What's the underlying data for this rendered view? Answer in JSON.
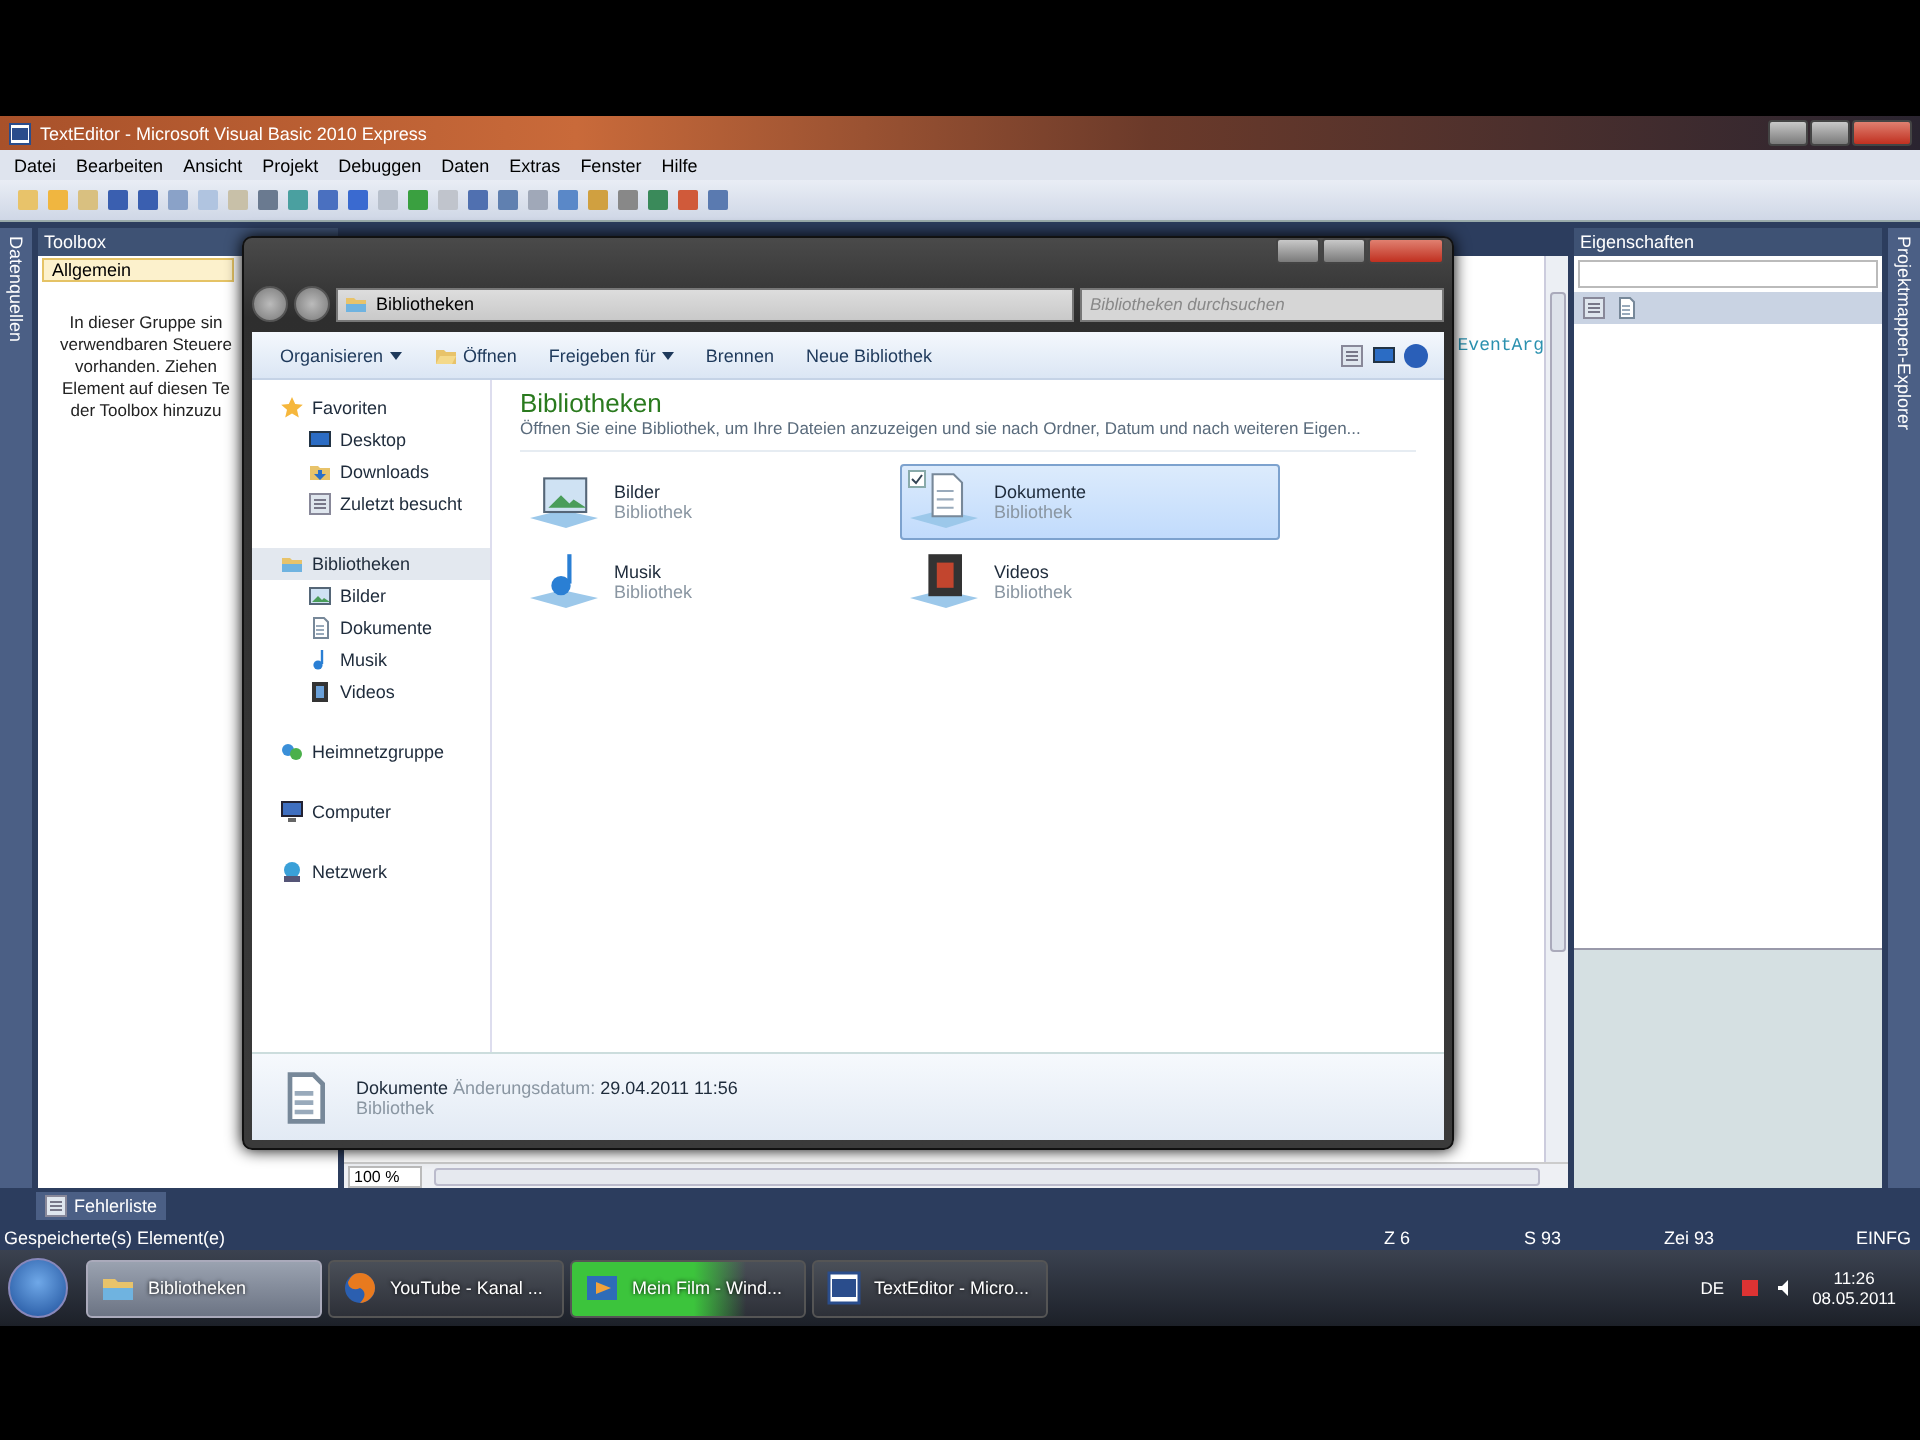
{
  "ide": {
    "title": "TextEditor - Microsoft Visual Basic 2010 Express",
    "menu": [
      "Datei",
      "Bearbeiten",
      "Ansicht",
      "Projekt",
      "Debuggen",
      "Daten",
      "Extras",
      "Fenster",
      "Hilfe"
    ],
    "left_tab": "Datenquellen",
    "toolbox": {
      "title": "Toolbox",
      "group": "Allgemein",
      "hint_lines": [
        "In dieser Gruppe sin",
        "verwendbaren Steuere",
        "vorhanden. Ziehen",
        "Element auf diesen Te",
        "der Toolbox hinzuzu"
      ]
    },
    "editor": {
      "code_fragment": "EventArg",
      "zoom": "100 %"
    },
    "properties": {
      "title": "Eigenschaften"
    },
    "right_tab": "Projektmappen-Explorer",
    "bottom_tab": "Fehlerliste",
    "status_bar": {
      "message": "Gespeicherte(s) Element(e)",
      "line": "Z 6",
      "column": "S 93",
      "char": "Zei 93",
      "mode": "EINFG"
    }
  },
  "explorer": {
    "address": "Bibliotheken",
    "search": {
      "placeholder": "Bibliotheken durchsuchen"
    },
    "commands": [
      {
        "label": "Organisieren",
        "kind": "menu"
      },
      {
        "label": "Öffnen",
        "kind": "open"
      },
      {
        "label": "Freigeben für",
        "kind": "menu"
      },
      {
        "label": "Brennen",
        "kind": "plain"
      },
      {
        "label": "Neue Bibliothek",
        "kind": "plain"
      }
    ],
    "tree": [
      {
        "label": "Favoriten",
        "kind": "star",
        "selected": false,
        "children": [
          {
            "label": "Desktop",
            "kind": "desktop",
            "selected": false
          },
          {
            "label": "Downloads",
            "kind": "download",
            "selected": false
          },
          {
            "label": "Zuletzt besucht",
            "kind": "recent",
            "selected": false
          }
        ]
      },
      {
        "label": "Bibliotheken",
        "kind": "library",
        "selected": true,
        "children": [
          {
            "label": "Bilder",
            "kind": "pictures",
            "selected": false
          },
          {
            "label": "Dokumente",
            "kind": "documents",
            "selected": false
          },
          {
            "label": "Musik",
            "kind": "music",
            "selected": false
          },
          {
            "label": "Videos",
            "kind": "videos",
            "selected": false
          }
        ]
      },
      {
        "label": "Heimnetzgruppe",
        "kind": "homegroup",
        "selected": false
      },
      {
        "label": "Computer",
        "kind": "computer",
        "selected": false
      },
      {
        "label": "Netzwerk",
        "kind": "network",
        "selected": false
      }
    ],
    "heading": "Bibliotheken",
    "description": "Öffnen Sie eine Bibliothek, um Ihre Dateien anzuzeigen und sie nach Ordner, Datum und nach weiteren Eigen...",
    "libraries": [
      {
        "name": "Bilder",
        "type": "Bibliothek",
        "kind": "pictures",
        "selected": false,
        "checked": false
      },
      {
        "name": "Dokumente",
        "type": "Bibliothek",
        "kind": "documents",
        "selected": true,
        "checked": true
      },
      {
        "name": "Musik",
        "type": "Bibliothek",
        "kind": "music",
        "selected": false,
        "checked": false
      },
      {
        "name": "Videos",
        "type": "Bibliothek",
        "kind": "videos",
        "selected": false,
        "checked": false
      }
    ],
    "details": {
      "name": "Dokumente",
      "date_label": "Änderungsdatum:",
      "date": "29.04.2011 11:56",
      "type": "Bibliothek"
    }
  },
  "taskbar": {
    "items": [
      {
        "label": "Bibliotheken",
        "kind": "folder",
        "selected": true
      },
      {
        "label": "YouTube - Kanal ...",
        "kind": "browser",
        "selected": false
      },
      {
        "label": "Mein Film - Wind...",
        "kind": "movie",
        "selected": false,
        "level": 0.75
      },
      {
        "label": "TextEditor - Micro...",
        "kind": "vb",
        "selected": false
      }
    ],
    "language": "DE",
    "time": "11:26",
    "date": "08.05.2011"
  }
}
